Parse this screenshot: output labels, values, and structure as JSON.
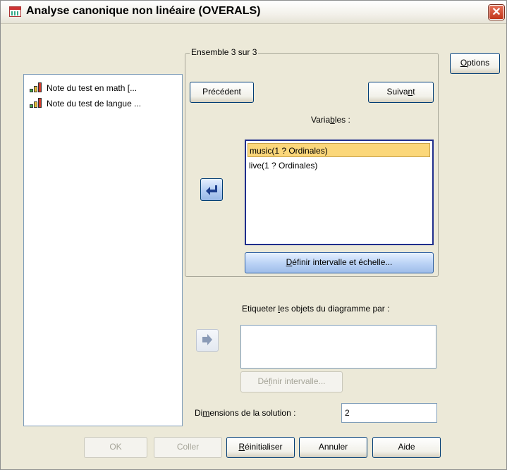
{
  "window": {
    "title": "Analyse canonique non linéaire (OVERALS)",
    "close_glyph": "✕",
    "app_icon": "spss-dialog-icon"
  },
  "source_variables": [
    {
      "label": "Note du test en math [...",
      "icon": "scale-measure-icon"
    },
    {
      "label": "Note du test de langue ...",
      "icon": "scale-measure-icon"
    }
  ],
  "set_group": {
    "legend": "Ensemble 3 sur 3",
    "prev_label": "Précédent",
    "next_label": "Suivant",
    "variables_label": "Variables :",
    "variables": [
      {
        "label": "music(1 ? Ordinales)",
        "selected": true
      },
      {
        "label": "live(1 ? Ordinales)",
        "selected": false
      }
    ],
    "define_range_scale_label": "Définir intervalle et échelle..."
  },
  "options_label": "Options",
  "label_objects": {
    "label": "Etiqueter les objets du diagramme par :",
    "define_range_label": "Définir intervalle..."
  },
  "dimensions": {
    "label": "Dimensions de la solution :",
    "value": "2"
  },
  "footer": {
    "ok": "OK",
    "paste": "Coller",
    "reset": "Réinitialiser",
    "cancel": "Annuler",
    "help": "Aide"
  },
  "colors": {
    "dialog_bg": "#ece9d8",
    "selection_highlight": "#fbd77a",
    "list_border_focus": "#1f2e8c"
  }
}
